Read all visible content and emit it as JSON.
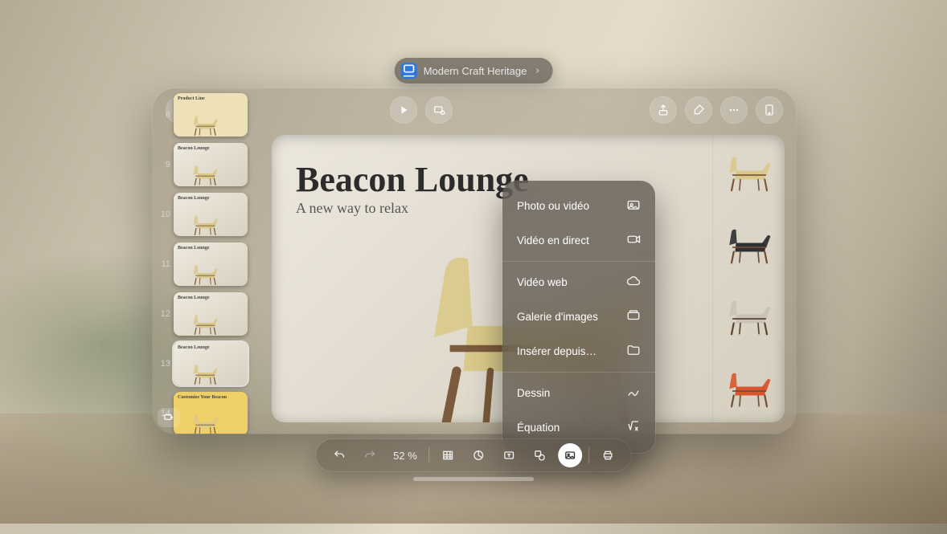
{
  "title_bar": {
    "doc_name": "Modern Craft Heritage"
  },
  "slide": {
    "title": "Beacon Lounge",
    "subtitle": "A new way to relax",
    "variants": [
      {
        "seat": "#d9c98a",
        "frame": "#7b5a3d"
      },
      {
        "seat": "#2f3034",
        "frame": "#6c4e36"
      },
      {
        "seat": "#c9c2b6",
        "frame": "#5a4530"
      },
      {
        "seat": "#d9552e",
        "frame": "#6f4f37"
      }
    ]
  },
  "thumbs": [
    {
      "n": 8,
      "title": "Product Line",
      "bg": "#efe1b7"
    },
    {
      "n": 9,
      "title": "Beacon Lounge"
    },
    {
      "n": 10,
      "title": "Beacon Lounge"
    },
    {
      "n": 11,
      "title": "Beacon Lounge"
    },
    {
      "n": 12,
      "title": "Beacon Lounge"
    },
    {
      "n": 13,
      "title": "Beacon Lounge",
      "selected": true
    },
    {
      "n": 14,
      "title": "Customize Your Beacon",
      "bg": "#eecf68"
    }
  ],
  "insert_menu": {
    "groups": [
      [
        {
          "label": "Photo ou vidéo",
          "icon": "photo"
        },
        {
          "label": "Vidéo en direct",
          "icon": "camera"
        }
      ],
      [
        {
          "label": "Vidéo web",
          "icon": "cloud"
        },
        {
          "label": "Galerie d'images",
          "icon": "gallery"
        },
        {
          "label": "Insérer depuis…",
          "icon": "folder"
        }
      ],
      [
        {
          "label": "Dessin",
          "icon": "scribble"
        },
        {
          "label": "Équation",
          "icon": "equation"
        }
      ]
    ]
  },
  "bottom": {
    "zoom": "52 %"
  }
}
